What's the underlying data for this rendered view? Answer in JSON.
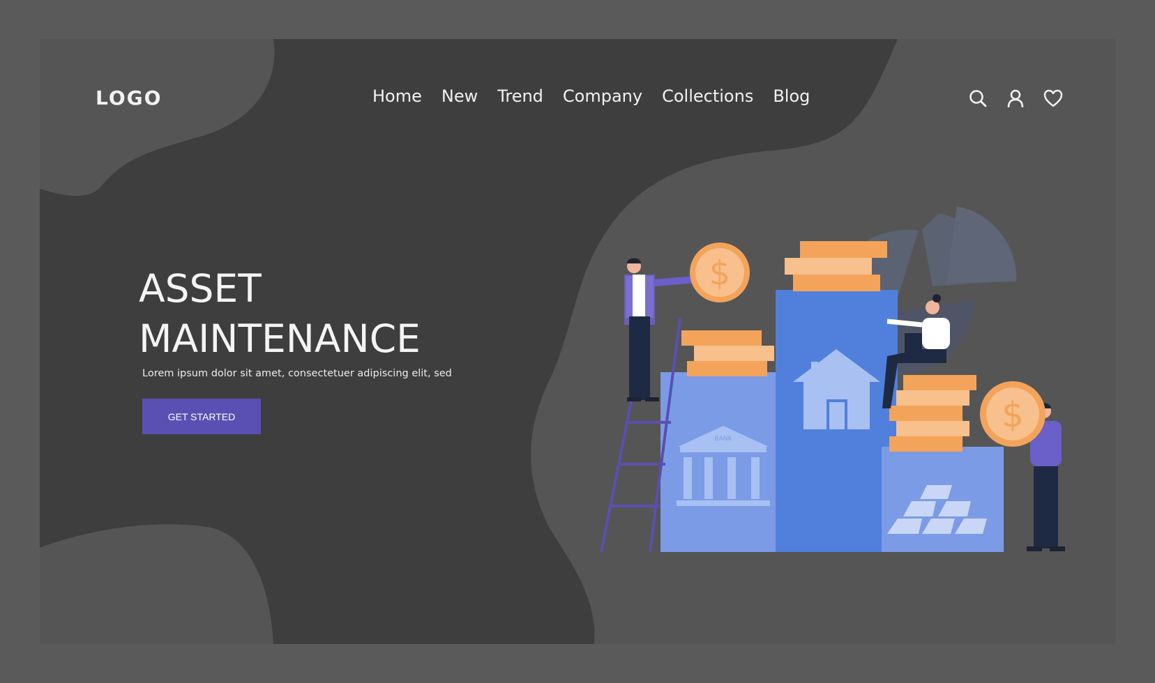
{
  "brand": {
    "logo": "LOGO"
  },
  "nav": {
    "items": [
      {
        "label": "Home"
      },
      {
        "label": "New"
      },
      {
        "label": "Trend"
      },
      {
        "label": "Company"
      },
      {
        "label": "Collections"
      },
      {
        "label": "Blog"
      }
    ],
    "icons": [
      "search-icon",
      "user-icon",
      "heart-icon"
    ]
  },
  "hero": {
    "title_line1": "ASSET",
    "title_line2": "MAINTENANCE",
    "subtitle": "Lorem ipsum dolor sit amet, consectetuer adipiscing elit, sed",
    "cta_label": "GET STARTED"
  },
  "illustration": {
    "bank_label": "BANK",
    "icons": [
      "dollar-coin-icon",
      "house-icon",
      "bank-icon",
      "gold-bars-icon",
      "pie-chart-icon"
    ]
  },
  "colors": {
    "page_bg": "#5a5a5a",
    "frame_bg": "#3e3e3e",
    "blob": "#555555",
    "accent": "#5a4fb2",
    "block_light": "#7b9be6",
    "block_dark": "#5080dc",
    "coin": "#f3a45a"
  }
}
